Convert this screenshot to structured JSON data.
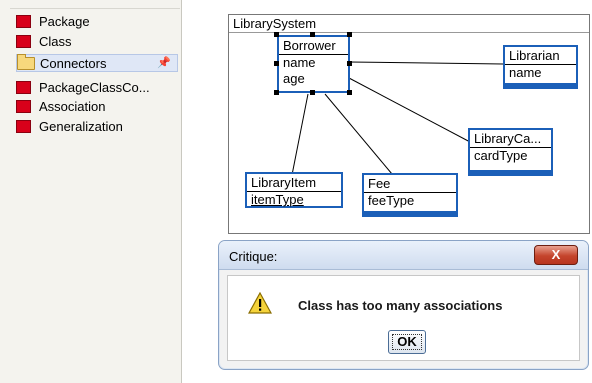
{
  "palette": {
    "items": [
      {
        "label": "Package"
      },
      {
        "label": "Class"
      },
      {
        "label": "Connectors"
      },
      {
        "label": "PackageClassCo..."
      },
      {
        "label": "Association"
      },
      {
        "label": "Generalization"
      }
    ]
  },
  "diagram": {
    "title": "LibrarySystem",
    "classes": {
      "borrower": {
        "name": "Borrower",
        "attrs": [
          "name",
          "age"
        ]
      },
      "librarian": {
        "name": "Librarian",
        "attrs": [
          "name"
        ]
      },
      "librarycard": {
        "name": "LibraryCa...",
        "attrs": [
          "cardType"
        ]
      },
      "libraryitem": {
        "name": "LibraryItem",
        "attrs": [
          "itemType"
        ]
      },
      "fee": {
        "name": "Fee",
        "attrs": [
          "feeType"
        ]
      }
    }
  },
  "dialog": {
    "title": "Critique:",
    "close_label": "X",
    "message": "Class has too many associations",
    "ok_label": "OK"
  },
  "colors": {
    "palette_icon": "#d8001a",
    "selection_border": "#1b5fb8",
    "close_button": "#c4442c"
  }
}
